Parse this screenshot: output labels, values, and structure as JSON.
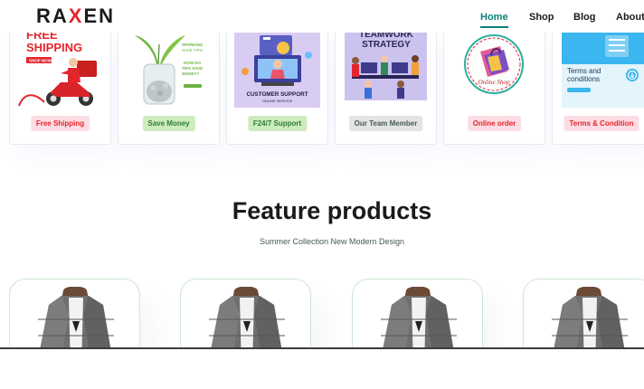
{
  "header": {
    "logo_start": "RA",
    "logo_x": "X",
    "logo_end": "EN",
    "nav": [
      "Home",
      "Shop",
      "Blog",
      "About"
    ]
  },
  "features": [
    {
      "tag": "Free Shipping",
      "tag_bg": "#fddde4",
      "art_text": [
        "FREE",
        "SHIPPING",
        "SHOP NOW"
      ]
    },
    {
      "tag": "Save Money",
      "tag_bg": "#cdebbc",
      "art_text": [
        "SPARKING",
        "SAVE TIPS",
        "HOW DO",
        "TIPS SAVE",
        "MONEY?"
      ]
    },
    {
      "tag": "F24/7 Support",
      "tag_bg": "#cdebbc",
      "art_text": [
        "CUSTOMER SUPPORT",
        "ONLINE SERVICE"
      ]
    },
    {
      "tag": "Our Team Member",
      "tag_bg": "#d1e8f2",
      "art_text": [
        "TEAMWORK",
        "STRATEGY"
      ]
    },
    {
      "tag": "Online order",
      "tag_bg": "#fddde4",
      "art_text": [
        "Online Shop"
      ]
    },
    {
      "tag": "Terms & Condition",
      "tag_bg": "#fddde4",
      "art_text": [
        "Terms and",
        "conditions"
      ]
    }
  ],
  "section": {
    "title": "Feature products",
    "subtitle": "Summer Collection New Modern Design"
  },
  "products": [
    {
      "name": "jacket-product-1"
    },
    {
      "name": "jacket-product-2"
    },
    {
      "name": "jacket-product-3"
    },
    {
      "name": "jacket-product-4"
    }
  ],
  "colors": {
    "accent": "#088178",
    "logo_x": "#e3262e"
  }
}
